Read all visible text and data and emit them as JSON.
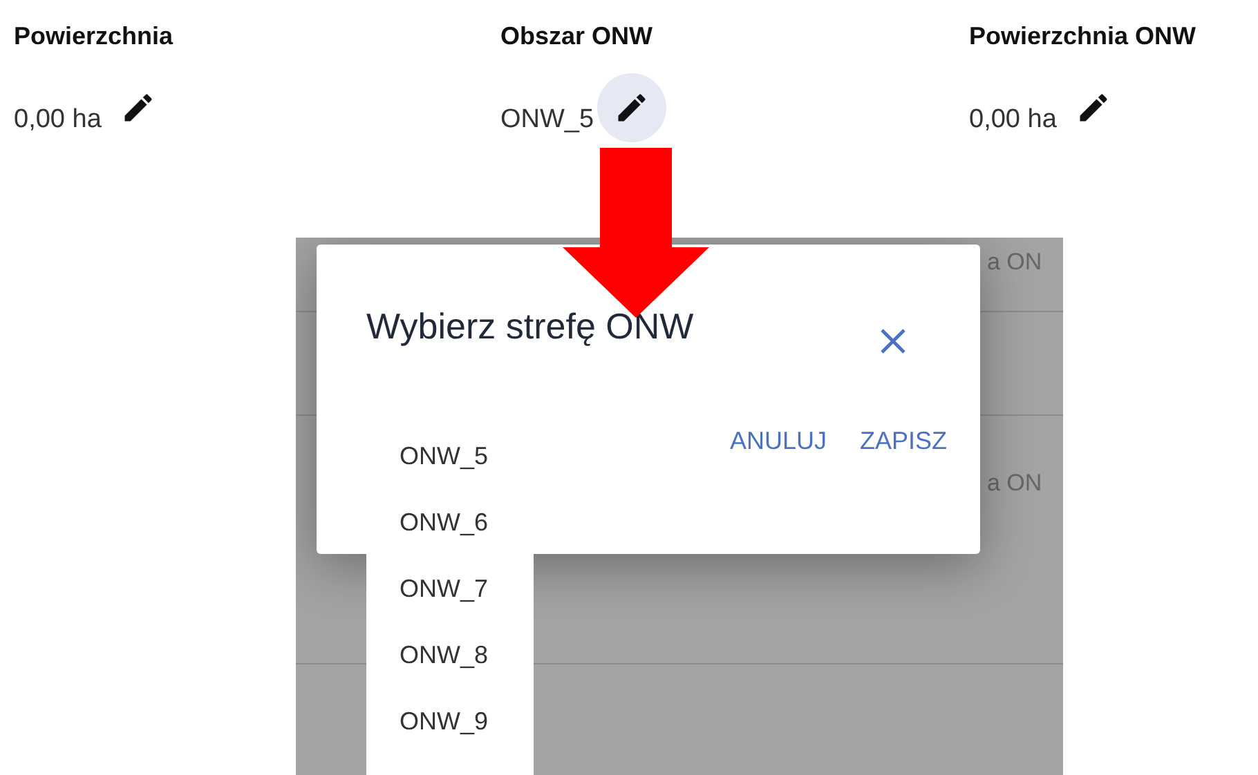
{
  "fields": [
    {
      "label": "Powierzchnia",
      "value": "0,00 ha",
      "edit_highlighted": false
    },
    {
      "label": "Obszar ONW",
      "value": "ONW_5",
      "edit_highlighted": true
    },
    {
      "label": "Powierzchnia ONW",
      "value": "0,00 ha",
      "edit_highlighted": false
    }
  ],
  "background_table": {
    "cells": [
      "a ON",
      "a ON"
    ]
  },
  "dialog": {
    "title": "Wybierz strefę ONW",
    "buttons": [
      "ANULUJ",
      "ZAPISZ"
    ]
  },
  "dropdown": {
    "options": [
      "ONW_5",
      "ONW_6",
      "ONW_7",
      "ONW_8",
      "ONW_9"
    ]
  }
}
